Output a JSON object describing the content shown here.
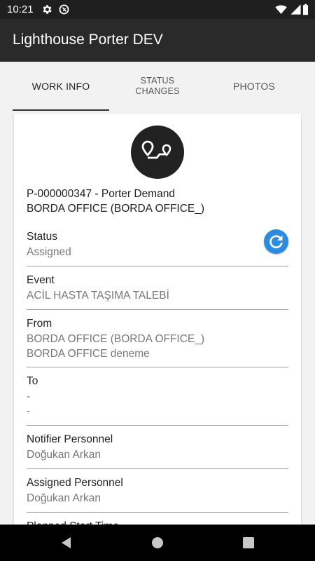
{
  "status_bar": {
    "time": "10:21"
  },
  "app_bar": {
    "title": "Lighthouse Porter DEV"
  },
  "tabs": [
    {
      "label": "WORK INFO",
      "active": true
    },
    {
      "label": "STATUS\nCHANGES",
      "active": false
    },
    {
      "label": "PHOTOS",
      "active": false
    }
  ],
  "work_info": {
    "summary_line1": "P-000000347 - Porter Demand",
    "summary_line2": "BORDA OFFICE (BORDA OFFICE_)",
    "fields": {
      "status": {
        "label": "Status",
        "value": "Assigned"
      },
      "event": {
        "label": "Event",
        "value": "ACİL HASTA TAŞIMA TALEBİ"
      },
      "from": {
        "label": "From",
        "value1": "BORDA OFFICE (BORDA OFFICE_)",
        "value2": "BORDA OFFICE deneme"
      },
      "to": {
        "label": "To",
        "value1": "-",
        "value2": "-"
      },
      "notifier": {
        "label": "Notifier Personnel",
        "value": "Doğukan Arkan"
      },
      "assigned": {
        "label": "Assigned Personnel",
        "value": "Doğukan Arkan"
      },
      "planned_start": {
        "label": "Planned Start Time"
      }
    }
  },
  "colors": {
    "accent": "#2a8be0",
    "appbar": "#2a2a2a",
    "statusbar": "#1f1f1f"
  },
  "icons": [
    "settings-icon",
    "sync-disabled-icon",
    "wifi-icon",
    "signal-icon",
    "battery-icon",
    "route-icon",
    "refresh-icon",
    "back-icon",
    "home-icon",
    "recents-icon"
  ]
}
